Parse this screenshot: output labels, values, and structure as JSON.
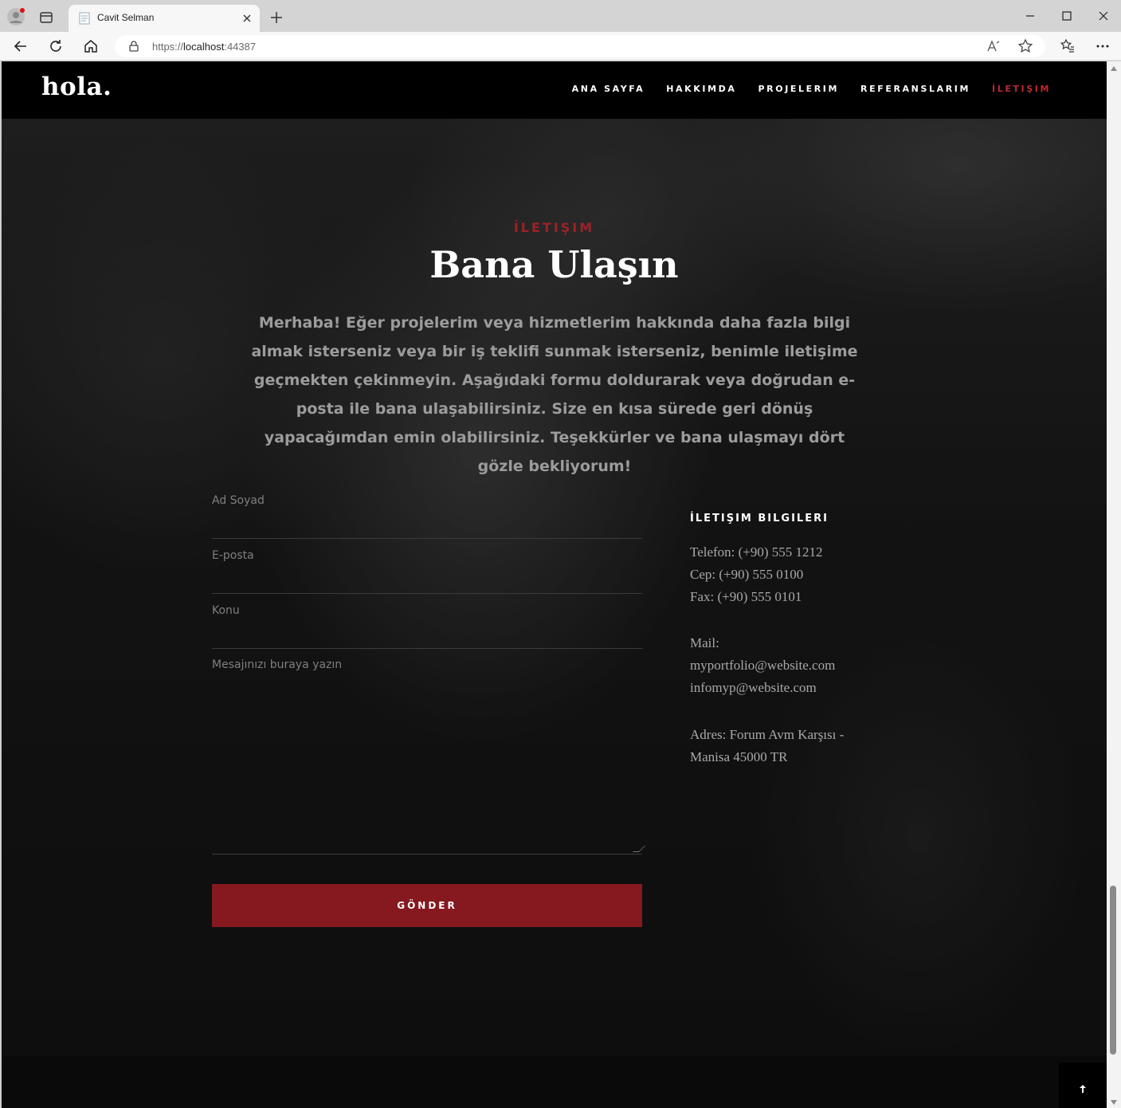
{
  "browser": {
    "tab_title": "Cavit Selman",
    "url_scheme": "https://",
    "url_host": "localhost",
    "url_port": ":44387"
  },
  "site": {
    "logo": "hola.",
    "nav": [
      {
        "label": "ANA SAYFA",
        "active": false
      },
      {
        "label": "HAKKIMDA",
        "active": false
      },
      {
        "label": "PROJELERIM",
        "active": false
      },
      {
        "label": "REFERANSLARIM",
        "active": false
      },
      {
        "label": "İLETIŞIM",
        "active": true
      }
    ],
    "accent": "#85191f",
    "accent_text": "#c1272d"
  },
  "contact_section": {
    "eyebrow": "İLETIŞIM",
    "title": "Bana Ulaşın",
    "lead": "Merhaba! Eğer projelerim veya hizmetlerim hakkında daha fazla bilgi almak isterseniz veya bir iş teklifi sunmak isterseniz, benimle iletişime geçmekten çekinmeyin. Aşağıdaki formu doldurarak veya doğrudan e-posta ile bana ulaşabilirsiniz. Size en kısa sürede geri dönüş yapacağımdan emin olabilirsiniz. Teşekkürler ve bana ulaşmayı dört gözle bekliyorum!"
  },
  "form": {
    "name_placeholder": "Ad Soyad",
    "email_placeholder": "E-posta",
    "subject_placeholder": "Konu",
    "message_placeholder": "Mesajınızı buraya yazın",
    "submit_label": "GÖNDER"
  },
  "info": {
    "heading": "İLETIŞIM BILGILERI",
    "phone": "Telefon: (+90) 555 1212",
    "mobile": "Cep: (+90) 555 0100",
    "fax": "Fax: (+90) 555 0101",
    "mail_label": "Mail:",
    "mail_1": "myportfolio@website.com",
    "mail_2": "infomyp@website.com",
    "address_1": "Adres: Forum Avm Karşısı -",
    "address_2": "Manisa 45000 TR"
  }
}
